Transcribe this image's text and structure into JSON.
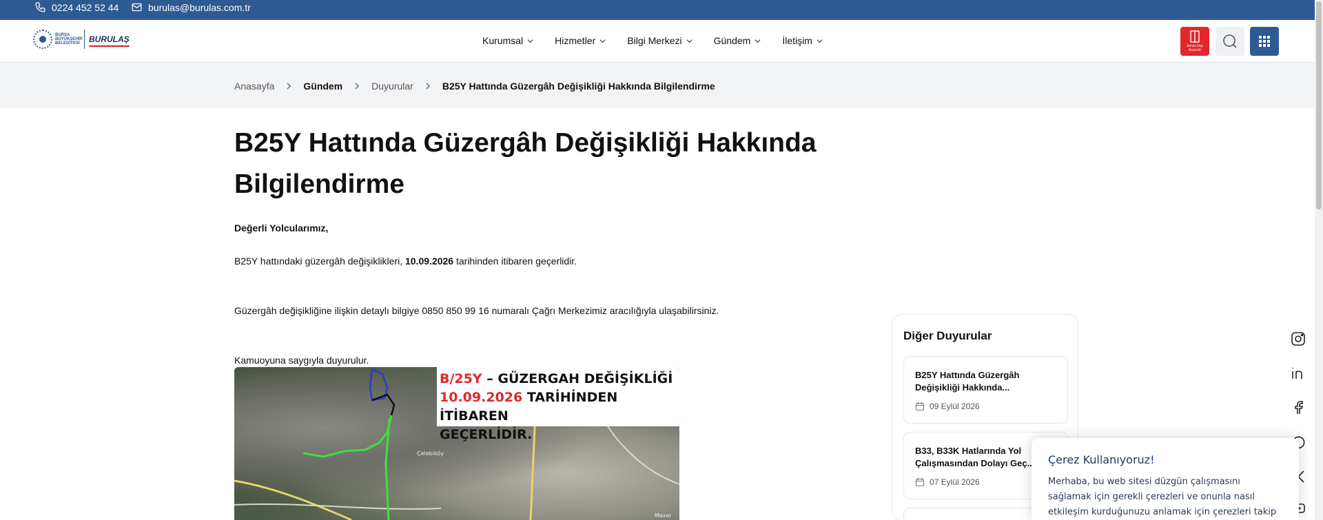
{
  "topbar": {
    "phone": "0224 452 52 44",
    "email": "burulas@burulas.com.tr",
    "bg_color": "#2e5a94"
  },
  "header": {
    "logo_city": "BURSA BÜYÜKŞEHİR BELEDİYESİ",
    "logo_brand": "BURULAŞ",
    "nav": [
      {
        "label": "Kurumsal"
      },
      {
        "label": "Hizmetler"
      },
      {
        "label": "Bilgi Merkezi"
      },
      {
        "label": "Gündem"
      },
      {
        "label": "İletişim"
      }
    ],
    "out_of_service_label": "Servis Dışı Asansör",
    "accent_red": "#e3262d"
  },
  "breadcrumb": [
    {
      "label": "Anasayfa",
      "bold": false
    },
    {
      "label": "Gündem",
      "bold": true
    },
    {
      "label": "Duyurular",
      "bold": false
    },
    {
      "label": "B25Y Hattında Güzergâh Değişikliği Hakkında Bilgilendirme",
      "bold": true
    }
  ],
  "article": {
    "title": "B25Y Hattında Güzergâh Değişikliği Hakkında Bilgilendirme",
    "greeting": "Değerli Yolcularımız,",
    "p1_before": "B25Y hattındaki güzergâh değişiklikleri, ",
    "p1_date": "10.09.2026",
    "p1_after": " tarihinden itibaren geçerlidir.",
    "p2": "Güzergâh değişikliğine ilişkin detaylı bilgiye 0850 850 99 16 numaralı Çağrı Merkezimiz aracılığıyla ulaşabilirsiniz.",
    "p3": "Kamuoyuna saygıyla duyurulur.",
    "image_caption": {
      "line1_red": "B/25Y",
      "line1_rest": " – GÜZERGAH DEĞİŞİKLİĞİ",
      "line2_red": "10.09.2026",
      "line2_rest": " TARİHİNDEN İTİBAREN",
      "line3": "GEÇERLİDİR."
    },
    "map_place": "Çelebiköy",
    "map_credit": "Maxar"
  },
  "sidebar": {
    "title": "Diğer Duyurular",
    "items": [
      {
        "title": "B25Y Hattında Güzergâh Değişikliği Hakkında...",
        "date": "09 Eylül 2026"
      },
      {
        "title": "B33, B33K Hatlarında Yol Çalışmasından Dolayı Geç...",
        "date": "07 Eylül 2026"
      }
    ]
  },
  "social": {
    "icons": [
      "instagram-icon",
      "linkedin-icon",
      "facebook-icon",
      "whatsapp-icon",
      "x-icon",
      "youtube-icon"
    ]
  },
  "cookie": {
    "title": "Çerez Kullanıyoruz!",
    "text": "Merhaba, bu web sitesi düzgün çalışmasını sağlamak için gerekli çerezleri ve onunla nasıl etkileşim kurduğunuzu anlamak için çerezleri takip eder."
  }
}
